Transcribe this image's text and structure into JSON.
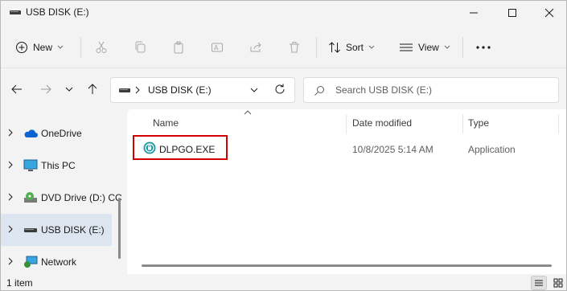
{
  "window": {
    "title": "USB DISK (E:)"
  },
  "toolbar": {
    "new_label": "New",
    "sort_label": "Sort",
    "view_label": "View"
  },
  "address": {
    "path": "USB DISK (E:)"
  },
  "search": {
    "placeholder": "Search USB DISK (E:)"
  },
  "nav": {
    "items": [
      {
        "label": "OneDrive",
        "icon": "onedrive-icon"
      },
      {
        "label": "This PC",
        "icon": "this-pc-icon"
      },
      {
        "label": "DVD Drive (D:) CC",
        "icon": "dvd-drive-icon"
      },
      {
        "label": "USB DISK (E:)",
        "icon": "usb-drive-icon",
        "selected": true
      },
      {
        "label": "Network",
        "icon": "network-icon"
      }
    ]
  },
  "columns": {
    "name": "Name",
    "date_modified": "Date modified",
    "type": "Type"
  },
  "files": [
    {
      "name": "DLPGO.EXE",
      "date_modified": "10/8/2025 5:14 AM",
      "type": "Application",
      "icon": "app-exe-icon"
    }
  ],
  "status": {
    "item_count": "1 item"
  },
  "colors": {
    "accent": "#0067c0",
    "selection": "#dde6f0",
    "highlight_box": "#d40000"
  }
}
